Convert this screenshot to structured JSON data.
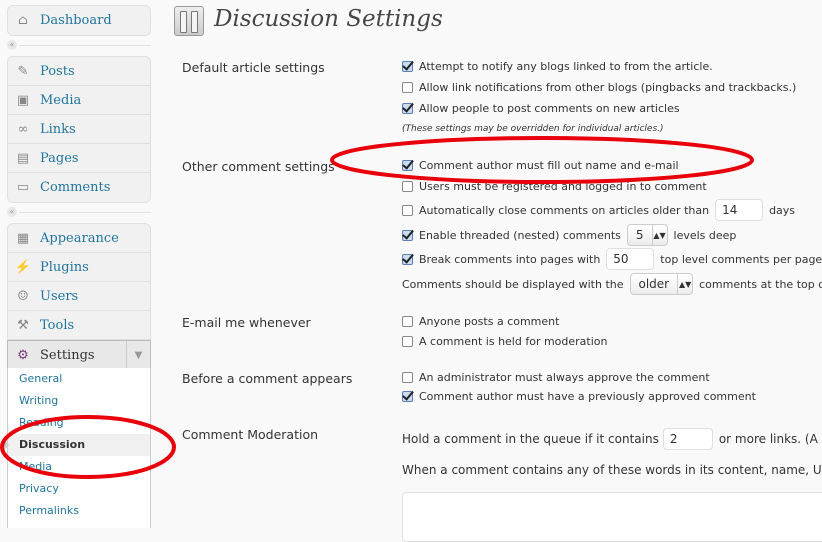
{
  "sidebar": {
    "dashboard": {
      "label": "Dashboard",
      "icon": "home-icon"
    },
    "collapse_icon": "«",
    "group1": [
      {
        "label": "Posts",
        "icon": "pushpin-icon"
      },
      {
        "label": "Media",
        "icon": "media-icon"
      },
      {
        "label": "Links",
        "icon": "chain-link-icon"
      },
      {
        "label": "Pages",
        "icon": "pages-icon"
      },
      {
        "label": "Comments",
        "icon": "comment-bubble-icon"
      }
    ],
    "group2": [
      {
        "label": "Appearance",
        "icon": "appearance-icon"
      },
      {
        "label": "Plugins",
        "icon": "plug-icon"
      },
      {
        "label": "Users",
        "icon": "users-icon"
      },
      {
        "label": "Tools",
        "icon": "tools-icon"
      }
    ],
    "settings": {
      "label": "Settings",
      "toggle": "▼"
    },
    "submenu": [
      {
        "label": "General",
        "current": false
      },
      {
        "label": "Writing",
        "current": false
      },
      {
        "label": "Reading",
        "current": false
      },
      {
        "label": "Discussion",
        "current": true
      },
      {
        "label": "Media",
        "current": false
      },
      {
        "label": "Privacy",
        "current": false
      },
      {
        "label": "Permalinks",
        "current": false
      }
    ]
  },
  "page": {
    "title": "Discussion Settings",
    "sections": {
      "default_article": {
        "label": "Default article settings",
        "options": [
          {
            "label": "Attempt to notify any blogs linked to from the article.",
            "checked": true
          },
          {
            "label": "Allow link notifications from other blogs (pingbacks and trackbacks.)",
            "checked": false
          },
          {
            "label": "Allow people to post comments on new articles",
            "checked": true
          }
        ],
        "note": "(These settings may be overridden for individual articles.)"
      },
      "other_comment": {
        "label": "Other comment settings",
        "require_name_email": {
          "label": "Comment author must fill out name and e-mail",
          "checked": true
        },
        "registration_required": {
          "label": "Users must be registered and logged in to comment",
          "checked": false
        },
        "auto_close": {
          "label_before": "Automatically close comments on articles older than",
          "value": "14",
          "label_after": "days",
          "checked": false
        },
        "threaded": {
          "label_before": "Enable threaded (nested) comments",
          "value": "5",
          "label_after": "levels deep",
          "checked": true
        },
        "paged": {
          "label_before": "Break comments into pages with",
          "value": "50",
          "label_after": "top level comments per page",
          "checked": true
        },
        "order": {
          "label_before": "Comments should be displayed with the",
          "value": "older",
          "label_after": "comments at the top of each page"
        }
      },
      "email_me": {
        "label": "E-mail me whenever",
        "options": [
          {
            "label": "Anyone posts a comment",
            "checked": false
          },
          {
            "label": "A comment is held for moderation",
            "checked": false
          }
        ]
      },
      "before_appears": {
        "label": "Before a comment appears",
        "options": [
          {
            "label": "An administrator must always approve the comment",
            "checked": false
          },
          {
            "label": "Comment author must have a previously approved comment",
            "checked": true
          }
        ]
      },
      "moderation": {
        "label": "Comment Moderation",
        "hold_before": "Hold a comment in the queue if it contains",
        "hold_value": "2",
        "hold_after": "or more links. (A common characteristic of comment spam is a large number of hyperlinks.)",
        "words_text": "When a comment contains any of these words in its content, name, URL, e-mail, or IP, it will be held in the moderation queue.",
        "words_value": ""
      }
    }
  },
  "annotations": {
    "color": "#e8000b"
  }
}
